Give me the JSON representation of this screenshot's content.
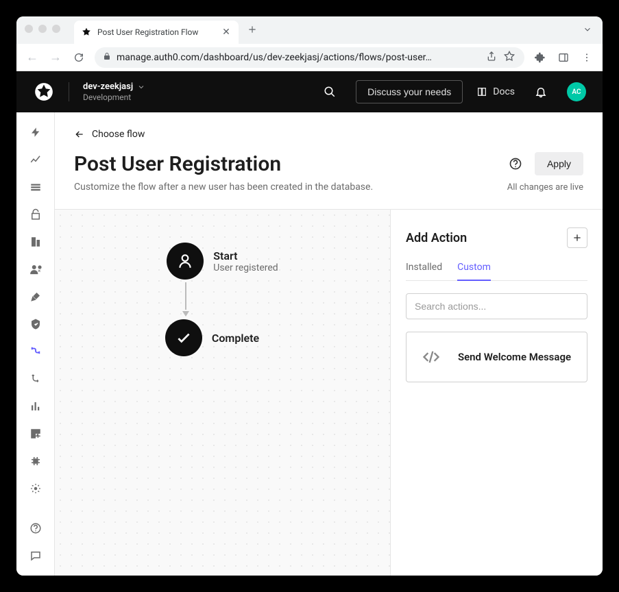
{
  "browser": {
    "tab_title": "Post User Registration Flow",
    "url": "manage.auth0.com/dashboard/us/dev-zeekjasj/actions/flows/post-user…"
  },
  "header": {
    "tenant_name": "dev-zeekjasj",
    "tenant_env": "Development",
    "discuss_label": "Discuss your needs",
    "docs_label": "Docs",
    "avatar_initials": "AC"
  },
  "page": {
    "breadcrumb": "Choose flow",
    "title": "Post User Registration",
    "subtitle": "Customize the flow after a new user has been created in the database.",
    "apply_label": "Apply",
    "changes_status": "All changes are live"
  },
  "flow": {
    "start": {
      "title": "Start",
      "subtitle": "User registered"
    },
    "complete": {
      "title": "Complete"
    }
  },
  "panel": {
    "title": "Add Action",
    "tabs": {
      "installed": "Installed",
      "custom": "Custom"
    },
    "search_placeholder": "Search actions...",
    "actions": [
      {
        "name": "Send Welcome Message"
      }
    ]
  }
}
